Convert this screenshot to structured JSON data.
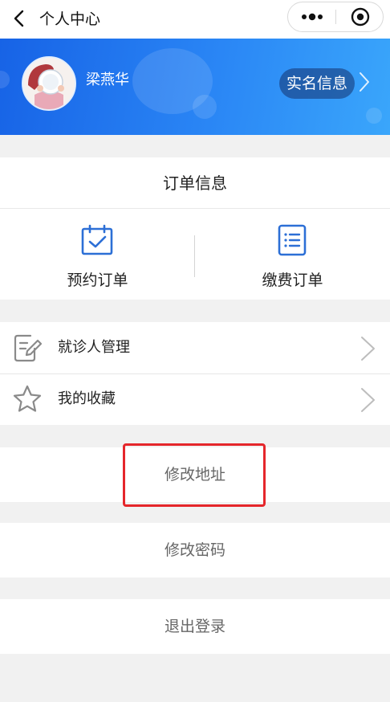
{
  "navbar": {
    "title": "个人中心",
    "back_icon": "chevron-left-icon",
    "more_icon": "more-dots-icon",
    "close_icon": "target-circle-icon"
  },
  "profile": {
    "name": "梁燕华",
    "verify_label": "实名信息",
    "banner_color": "#2a86f5"
  },
  "orders": {
    "title": "订单信息",
    "items": [
      {
        "label": "预约订单",
        "icon": "calendar-check-icon"
      },
      {
        "label": "缴费订单",
        "icon": "list-document-icon"
      }
    ]
  },
  "menu": {
    "items": [
      {
        "label": "就诊人管理",
        "icon": "edit-note-icon"
      },
      {
        "label": "我的收藏",
        "icon": "star-outline-icon"
      }
    ]
  },
  "actions": {
    "change_address": "修改地址",
    "change_password": "修改密码",
    "logout": "退出登录"
  },
  "colors": {
    "accent": "#2c6fd6",
    "highlight": "#e5262b"
  }
}
